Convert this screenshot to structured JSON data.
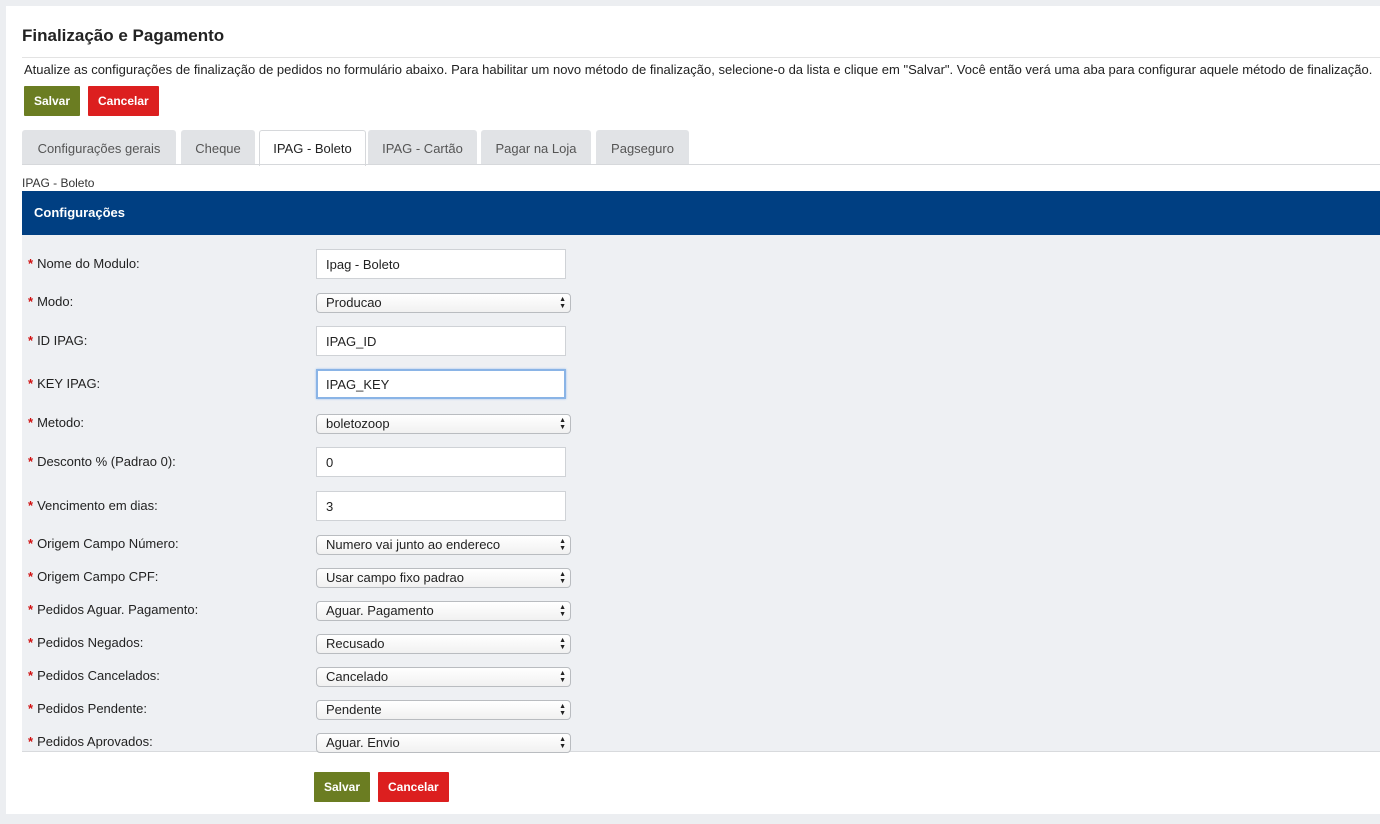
{
  "page": {
    "title": "Finalização e Pagamento",
    "intro": "Atualize as configurações de finalização de pedidos no formulário abaixo. Para habilitar um novo método de finalização, selecione-o da lista e clique em \"Salvar\". Você então verá uma aba para configurar aquele método de finalização."
  },
  "actions": {
    "save_label": "Salvar",
    "cancel_label": "Cancelar"
  },
  "tabs": [
    {
      "label": "Configurações gerais"
    },
    {
      "label": "Cheque"
    },
    {
      "label": "IPAG - Boleto"
    },
    {
      "label": "IPAG - Cartão"
    },
    {
      "label": "Pagar na Loja"
    },
    {
      "label": "Pagseguro"
    }
  ],
  "active_tab": "IPAG - Boleto",
  "section": {
    "label": "IPAG - Boleto",
    "header": "Configurações"
  },
  "required_marker": "*",
  "form": {
    "nome_modulo": {
      "label": "Nome do Modulo:",
      "value": "Ipag - Boleto"
    },
    "modo": {
      "label": "Modo:",
      "value": "Producao"
    },
    "id_ipag": {
      "label": "ID IPAG:",
      "value": "IPAG_ID"
    },
    "key_ipag": {
      "label": "KEY IPAG:",
      "value": "IPAG_KEY"
    },
    "metodo": {
      "label": "Metodo:",
      "value": "boletozoop"
    },
    "desconto": {
      "label": "Desconto % (Padrao 0):",
      "value": "0"
    },
    "vencimento": {
      "label": "Vencimento em dias:",
      "value": "3"
    },
    "origem_numero": {
      "label": "Origem Campo Número:",
      "value": "Numero vai junto ao endereco"
    },
    "origem_cpf": {
      "label": "Origem Campo CPF:",
      "value": "Usar campo fixo padrao"
    },
    "aguar_pagamento": {
      "label": "Pedidos Aguar. Pagamento:",
      "value": "Aguar. Pagamento"
    },
    "negados": {
      "label": "Pedidos Negados:",
      "value": "Recusado"
    },
    "cancelados": {
      "label": "Pedidos Cancelados:",
      "value": "Cancelado"
    },
    "pendente": {
      "label": "Pedidos Pendente:",
      "value": "Pendente"
    },
    "aprovados": {
      "label": "Pedidos Aprovados:",
      "value": "Aguar. Envio"
    }
  },
  "colors": {
    "save": "#6b7d22",
    "cancel": "#dc1f1f",
    "header": "#003f82",
    "required": "#d01010"
  }
}
